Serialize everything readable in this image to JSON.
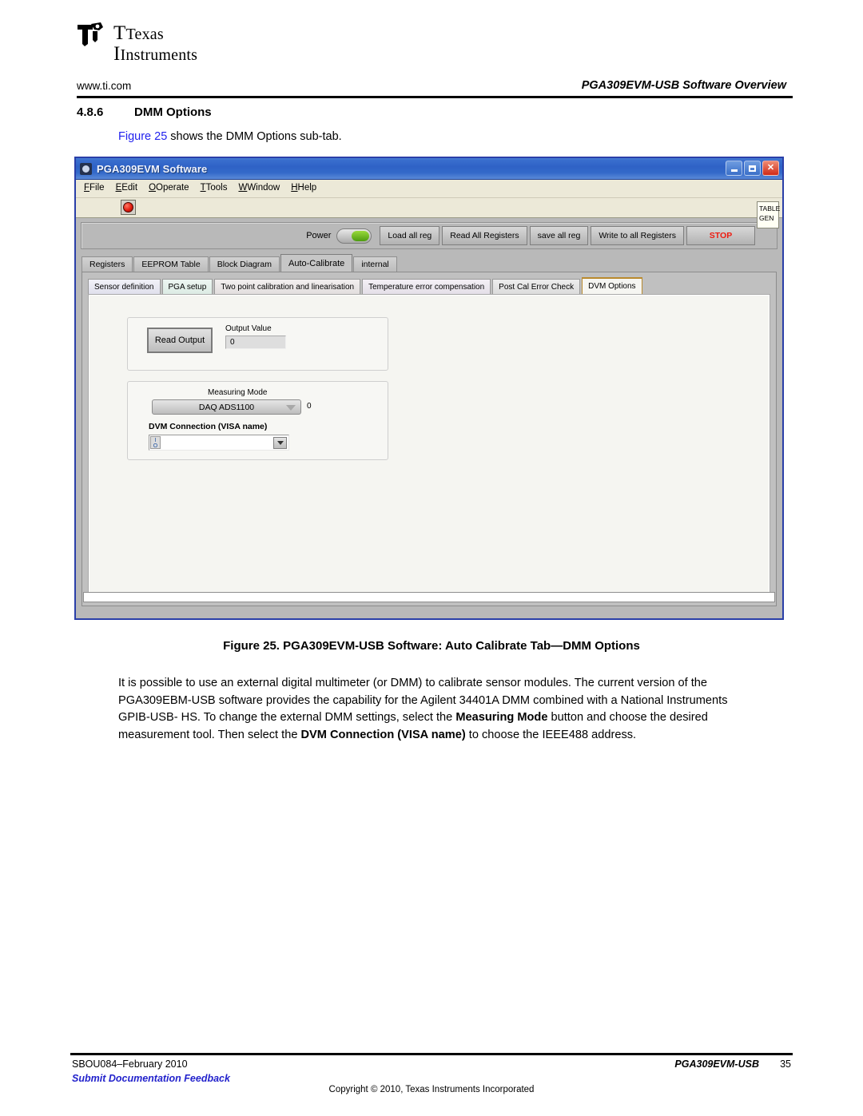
{
  "document": {
    "logo": {
      "line1": "Texas",
      "line2": "Instruments"
    },
    "header": {
      "url": "www.ti.com",
      "running_title": "PGA309EVM-USB Software Overview"
    },
    "section": {
      "number": "4.8.6",
      "title": "DMM Options"
    },
    "intro": {
      "xref": "Figure 25",
      "rest": " shows the DMM Options sub-tab."
    },
    "figure_caption": "Figure 25. PGA309EVM-USB Software: Auto Calibrate Tab—DMM Options",
    "body_paragraph": {
      "p1": "It is possible to use an external digital multimeter (or DMM) to calibrate sensor modules. The current version of the PGA309EBM-USB software provides the capability for the Agilent 34401A DMM combined with a National Instruments GPIB-USB- HS. To change the external DMM settings, select the ",
      "b1": "Measuring Mode",
      "p2": " button and choose the desired measurement tool. Then select the ",
      "b2": "DVM Connection (VISA name)",
      "p3": " to choose the IEEE488 address."
    },
    "footer": {
      "doc_date": "SBOU084–February 2010",
      "feedback": "Submit Documentation Feedback",
      "doc_name": "PGA309EVM-USB",
      "page": "35",
      "copyright": "Copyright © 2010, Texas Instruments Incorporated"
    }
  },
  "app": {
    "title": "PGA309EVM Software",
    "titlebar_icon": "app-icon",
    "window_buttons": {
      "minimize": "minimize-icon",
      "maximize": "maximize-icon",
      "close": "✕"
    },
    "menu": [
      {
        "label": "File",
        "accel": "F"
      },
      {
        "label": "Edit",
        "accel": "E"
      },
      {
        "label": "Operate",
        "accel": "O"
      },
      {
        "label": "Tools",
        "accel": "T"
      },
      {
        "label": "Window",
        "accel": "W"
      },
      {
        "label": "Help",
        "accel": "H"
      }
    ],
    "abort_button": "abort-stop-icon",
    "table_gen_button": {
      "line1": "TABLE",
      "line2": "GEN"
    },
    "toolbar": {
      "power_label": "Power",
      "power_state": "on",
      "buttons": [
        "Load all reg",
        "Read All Registers",
        "save all reg",
        "Write to all Registers"
      ],
      "stop_label": "STOP",
      "stop_color": "#ee1b10"
    },
    "tabs": [
      {
        "label": "Registers",
        "active": false
      },
      {
        "label": "EEPROM Table",
        "active": false
      },
      {
        "label": "Block Diagram",
        "active": false
      },
      {
        "label": "Auto-Calibrate",
        "active": true
      },
      {
        "label": "internal",
        "active": false
      }
    ],
    "subtabs": [
      {
        "label": "Sensor definition",
        "active": false
      },
      {
        "label": "PGA setup",
        "active": false
      },
      {
        "label": "Two point calibration and linearisation",
        "active": false
      },
      {
        "label": "Temperature error compensation",
        "active": false
      },
      {
        "label": "Post Cal Error Check",
        "active": false
      },
      {
        "label": "DVM Options",
        "active": true
      }
    ],
    "panel": {
      "read_group": {
        "read_button": "Read Output",
        "output_value_label": "Output Value",
        "output_value": "0"
      },
      "mode_group": {
        "measuring_mode_label": "Measuring Mode",
        "measuring_mode_value": "DAQ ADS1100",
        "measuring_mode_index": "0",
        "dvm_connection_label": "DVM Connection (VISA name)",
        "dvm_connection_value": "",
        "visa_icon": "visa-resource-icon"
      }
    }
  }
}
